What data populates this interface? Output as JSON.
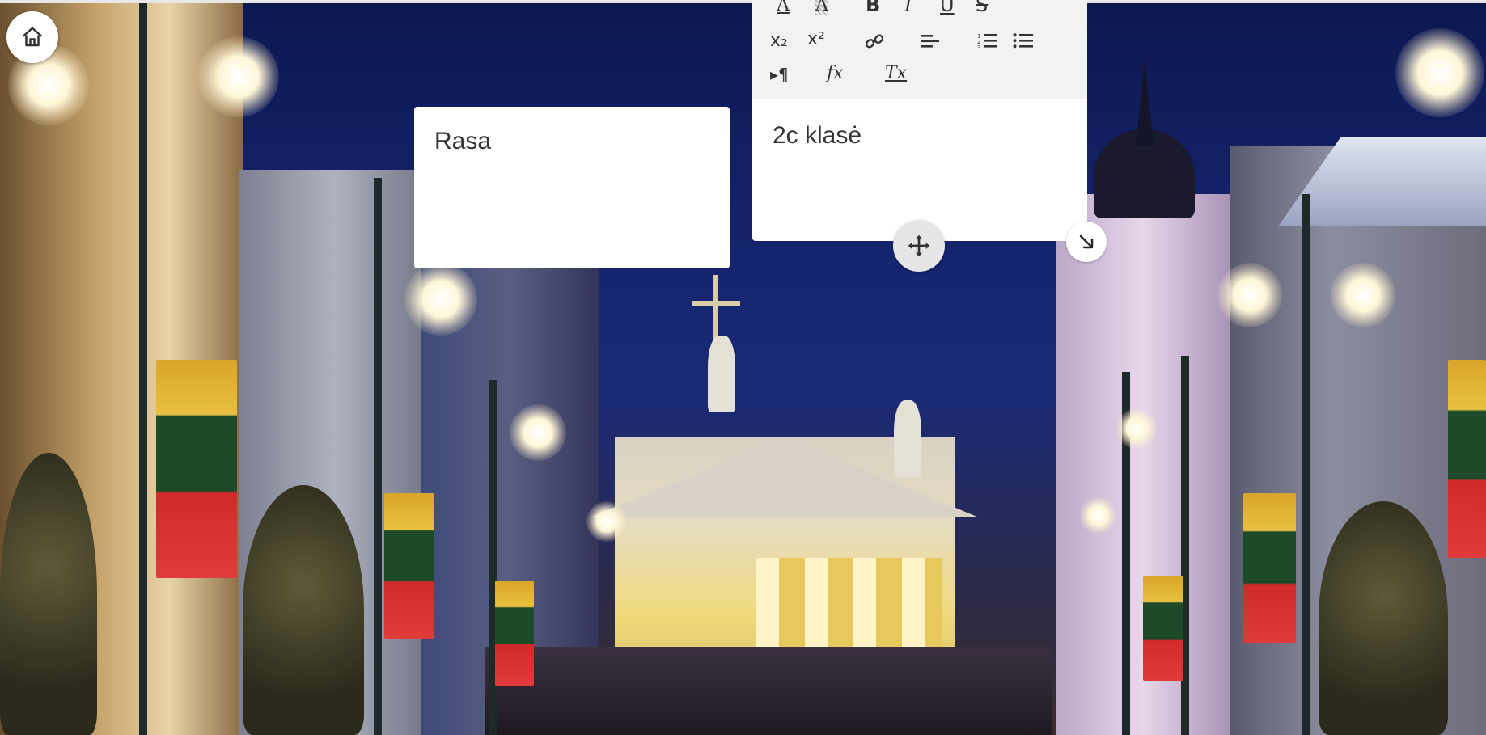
{
  "home": {
    "icon": "home-icon"
  },
  "notes": [
    {
      "text": "Rasa"
    },
    {
      "text": "2c klasė"
    }
  ],
  "editor": {
    "toolbar": {
      "rows": [
        [
          {
            "name": "text-color",
            "glyph": "A",
            "icon": "text-color-icon"
          },
          {
            "name": "background-color",
            "glyph": "A",
            "icon": "highlight-icon"
          },
          {
            "name": "bold",
            "glyph": "B",
            "icon": "bold-icon"
          },
          {
            "name": "italic",
            "glyph": "I",
            "icon": "italic-icon"
          },
          {
            "name": "underline",
            "glyph": "U",
            "icon": "underline-icon"
          },
          {
            "name": "strikethrough",
            "glyph": "S",
            "icon": "strikethrough-icon"
          }
        ],
        [
          {
            "name": "subscript",
            "glyph": "x₂",
            "icon": "subscript-icon"
          },
          {
            "name": "superscript",
            "glyph": "x²",
            "icon": "superscript-icon"
          },
          {
            "name": "link",
            "glyph": "🔗",
            "icon": "link-icon"
          },
          {
            "name": "align",
            "glyph": "≡",
            "icon": "align-left-icon"
          },
          {
            "name": "ordered-list",
            "glyph": "⋮≡",
            "icon": "ordered-list-icon"
          },
          {
            "name": "bullet-list",
            "glyph": "⁝≡",
            "icon": "bullet-list-icon"
          }
        ],
        [
          {
            "name": "text-direction",
            "glyph": "▸¶",
            "icon": "paragraph-direction-icon"
          },
          {
            "name": "formula",
            "glyph": "fx",
            "icon": "formula-icon"
          },
          {
            "name": "clear-format",
            "glyph": "Tx",
            "icon": "clear-format-icon"
          }
        ]
      ]
    }
  },
  "handles": {
    "move": "move-icon",
    "resize": "resize-arrow-icon"
  }
}
